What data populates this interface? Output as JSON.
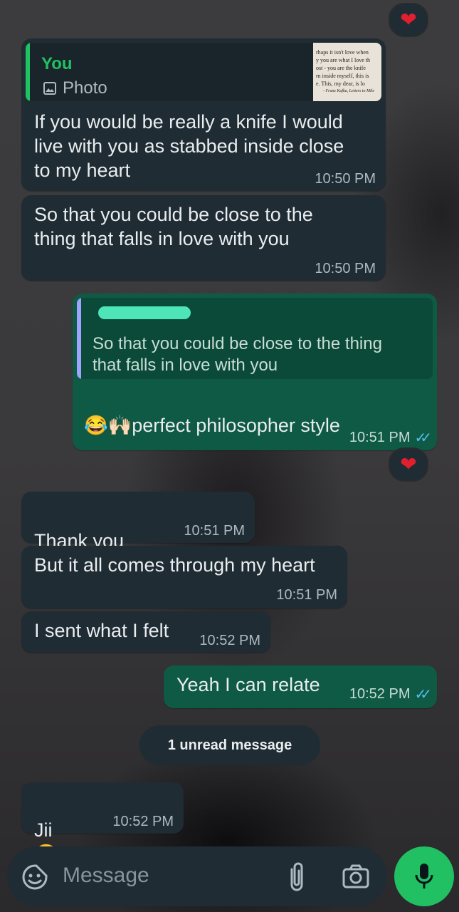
{
  "colors": {
    "incoming_bubble": "#1f2c33",
    "outgoing_bubble": "#0f5a45",
    "reply_bar_incoming": "#21c063",
    "reply_bar_outgoing": "#a1a4ff",
    "read_ticks": "#53bdeb",
    "mic_button": "#21c063",
    "heart": "#e0202e"
  },
  "messages": [
    {
      "direction": "incoming",
      "reply": {
        "author": "You",
        "type_label": "Photo",
        "thumb_lines": [
          "rhaps it isn't love when",
          "y you are what I love th",
          "ost - you are the knife",
          "rn inside myself, this is",
          "e. This, my dear, is lo",
          "- Franz Kafka, Letters to Mile"
        ]
      },
      "text": "If you would be really a knife I would\nlive with you as stabbed inside close\nto my heart",
      "time": "10:50 PM"
    },
    {
      "direction": "incoming",
      "text": "So that you could be close to the\nthing that falls in love with you",
      "time": "10:50 PM"
    },
    {
      "direction": "outgoing",
      "reply": {
        "text": "So that you could be close to the thing\nthat falls in love with you"
      },
      "emojis": "😂🙌🏻",
      "text": "perfect philosopher style",
      "time": "10:51 PM",
      "reaction": "heart"
    },
    {
      "direction": "incoming",
      "text": "Thank you",
      "emoji": "❤️",
      "time": "10:51 PM"
    },
    {
      "direction": "incoming",
      "text": "But it all comes through my heart",
      "time": "10:51 PM"
    },
    {
      "direction": "incoming",
      "text": "I sent what I felt",
      "time": "10:52 PM"
    },
    {
      "direction": "outgoing",
      "text": "Yeah I can relate",
      "time": "10:52 PM"
    },
    {
      "direction": "incoming",
      "text": "Jii",
      "emoji": "😊",
      "time": "10:52 PM"
    }
  ],
  "top_reaction": "heart",
  "unread_banner": "1 unread message",
  "composer": {
    "placeholder": "Message",
    "icons": [
      "sticker-icon",
      "attach-icon",
      "camera-icon",
      "mic-icon"
    ]
  }
}
